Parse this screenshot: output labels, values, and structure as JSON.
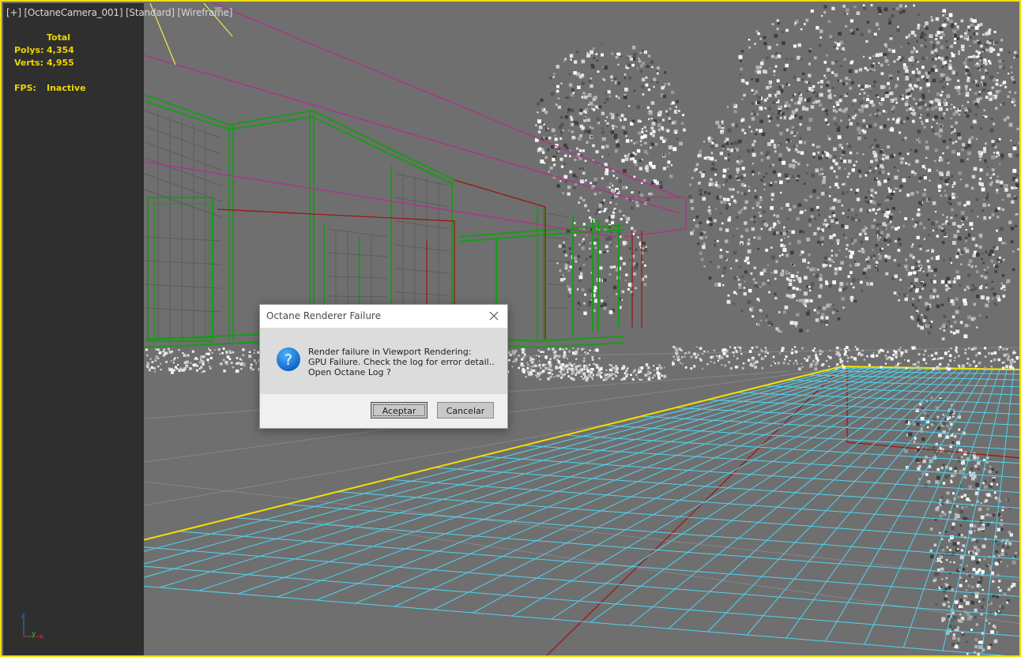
{
  "viewport": {
    "label_plus": "[+]",
    "label_camera": "[OctaneCamera_001]",
    "label_mode": "[Standard]",
    "label_shading": "[Wireframe]",
    "filter_icon": "funnel-icon"
  },
  "stats": {
    "header": "Total",
    "polys_label": "Polys:",
    "polys_value": "4,354",
    "verts_label": "Verts:",
    "verts_value": "4,955",
    "fps_label": "FPS:",
    "fps_value": "Inactive"
  },
  "gizmo": {
    "z": "z",
    "y": "y",
    "x": "x"
  },
  "dialog": {
    "title": "Octane Renderer Failure",
    "close_icon": "close-icon",
    "icon": "question-icon",
    "message_lines": [
      "Render failure in Viewport Rendering:",
      "GPU Failure. Check the log for error detail..",
      "Open Octane Log ?"
    ],
    "accept_label": "Aceptar",
    "cancel_label": "Cancelar"
  },
  "colors": {
    "viewport_bg": "#6f6f6f",
    "panel_bg": "#2f2f2f",
    "stats_text": "#f0d400",
    "border_active": "#f2e000",
    "grid": "#4fd4f0",
    "wire_green": "#1a9a1a",
    "wire_magenta": "#b0308a",
    "wire_red": "#a01010"
  }
}
